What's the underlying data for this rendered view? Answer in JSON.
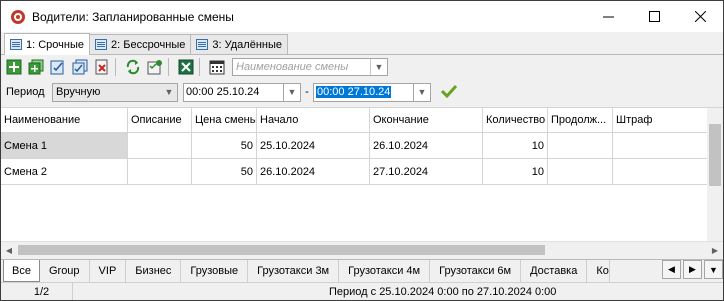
{
  "window": {
    "title": "Водители: Запланированные смены",
    "minimize": "—",
    "maximize": "☐",
    "close": "✕"
  },
  "tabs": [
    {
      "label": "1: Срочные",
      "active": true
    },
    {
      "label": "2: Бессрочные",
      "active": false
    },
    {
      "label": "3: Удалённые",
      "active": false
    }
  ],
  "toolbar": {
    "name_placeholder": "Наименование смены"
  },
  "period": {
    "label": "Период",
    "mode": "Вручную",
    "from": "00:00 25.10.24",
    "separator": "-",
    "to": "00:00 27.10.24"
  },
  "grid": {
    "columns": [
      "Наименование",
      "Описание",
      "Цена смены",
      "Начало",
      "Окончание",
      "Количество",
      "Продолж...",
      "Штраф"
    ],
    "rows": [
      [
        "Смена 1",
        "",
        "50",
        "25.10.2024",
        "26.10.2024",
        "10",
        "",
        ""
      ],
      [
        "Смена 2",
        "",
        "50",
        "26.10.2024",
        "27.10.2024",
        "10",
        "",
        ""
      ]
    ]
  },
  "group_tabs": [
    "Все",
    "Group",
    "VIP",
    "Бизнес",
    "Грузовые",
    "Грузотакси 3м",
    "Грузотакси 4м",
    "Грузотакси 6м",
    "Доставка",
    "Ко"
  ],
  "status": {
    "page": "1/2",
    "message": "Период с 25.10.2024 0:00 по 27.10.2024 0:00"
  },
  "colors": {
    "selection": "#0078d7",
    "confirm": "#6aa121",
    "excel": "#1e7145"
  }
}
